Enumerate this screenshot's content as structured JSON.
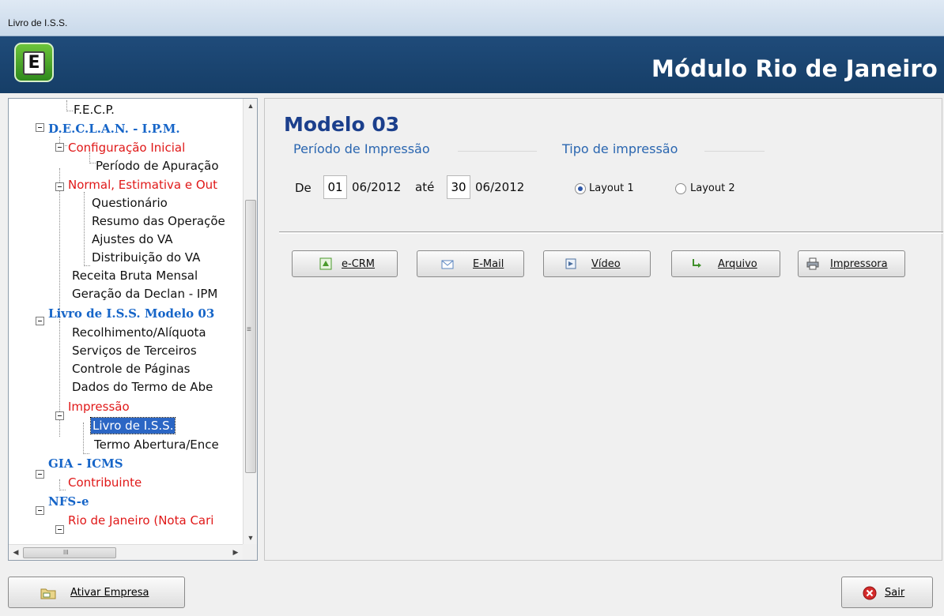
{
  "window": {
    "title": "Livro de I.S.S."
  },
  "header": {
    "logo_letter": "E",
    "module_title": "Módulo Rio de Janeiro"
  },
  "tree": {
    "items": [
      {
        "label": "F.E.C.P."
      },
      {
        "label": "D.E.C.L.A.N. - I.P.M."
      },
      {
        "label": "Configuração Inicial"
      },
      {
        "label": "Período de Apuração"
      },
      {
        "label": "Normal, Estimativa e Out"
      },
      {
        "label": "Questionário"
      },
      {
        "label": "Resumo das Operaçõe"
      },
      {
        "label": "Ajustes do VA"
      },
      {
        "label": "Distribuição do VA"
      },
      {
        "label": "Receita Bruta Mensal"
      },
      {
        "label": "Geração da Declan - IPM"
      },
      {
        "label": "Livro de I.S.S. Modelo 03"
      },
      {
        "label": "Recolhimento/Alíquota"
      },
      {
        "label": "Serviços de Terceiros"
      },
      {
        "label": "Controle de Páginas"
      },
      {
        "label": "Dados do Termo de Abe"
      },
      {
        "label": "Impressão"
      },
      {
        "label": "Livro de I.S.S."
      },
      {
        "label": "Termo Abertura/Ence"
      },
      {
        "label": "GIA - ICMS"
      },
      {
        "label": "Contribuinte"
      },
      {
        "label": "NFS-e"
      },
      {
        "label": "Rio de Janeiro (Nota Cari"
      }
    ],
    "scroll_glyph": "≡",
    "hscroll_glyph": "III"
  },
  "main": {
    "model_title": "Modelo 03",
    "periodo": {
      "title": "Período de Impressão",
      "de_label": "De",
      "start_day": "01",
      "start_month_year": "06/2012",
      "ate_label": "até",
      "end_day": "30",
      "end_month_year": "06/2012"
    },
    "tipo": {
      "title": "Tipo de impressão",
      "options": [
        "Layout 1",
        "Layout 2"
      ],
      "selected": "Layout 1"
    },
    "buttons": {
      "ecrm": "e-CRM",
      "email": "E-Mail",
      "video": "Vídeo",
      "arquivo": "Arquivo",
      "impressora": "Impressora"
    }
  },
  "footer": {
    "ativar_label": "Ativar Empresa",
    "sair_label": "Sair"
  },
  "colors": {
    "header_bg": "#1f4b7a",
    "accent_blue": "#1665c8",
    "accent_red": "#e01818",
    "title_blue": "#1b3f8c"
  }
}
